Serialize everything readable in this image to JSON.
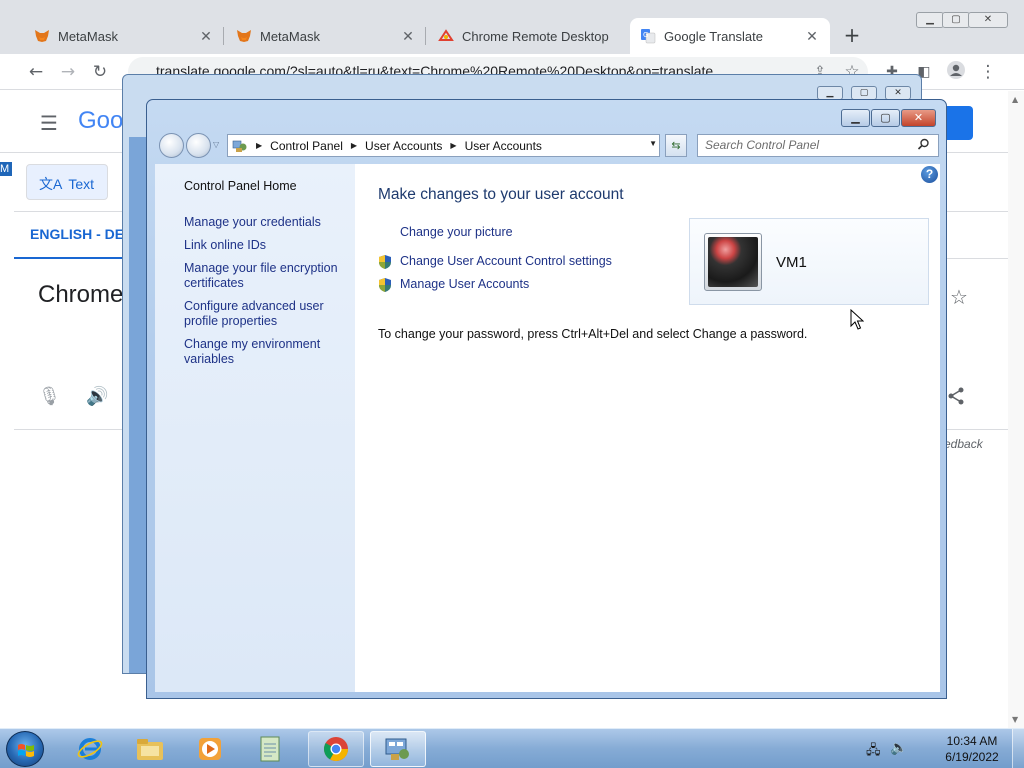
{
  "browser": {
    "tabs": [
      {
        "title": "MetaMask",
        "icon": "metamask-fox-icon",
        "active": false
      },
      {
        "title": "MetaMask",
        "icon": "metamask-fox-icon",
        "active": false
      },
      {
        "title": "Chrome Remote Desktop",
        "icon": "chrome-remote-desktop-icon",
        "active": false
      },
      {
        "title": "Google Translate",
        "icon": "google-translate-icon",
        "active": true
      }
    ],
    "new_tab_label": "+",
    "url": "translate.google.com/?sl=auto&tl=ru&text=Chrome%20Remote%20Desktop&op=translate"
  },
  "translate_page": {
    "logo_partial": "Goo",
    "text_tab": "Text",
    "source_lang_partial": "ENGLISH - DET",
    "source_text_partial": "Chrome",
    "feedback_partial": "edback"
  },
  "desktop_fragment": "M",
  "control_panel": {
    "breadcrumbs": [
      "Control Panel",
      "User Accounts",
      "User Accounts"
    ],
    "search_placeholder": "Search Control Panel",
    "nav": {
      "home": "Control Panel Home",
      "links": [
        "Manage your credentials",
        "Link online IDs",
        "Manage your file encryption certificates",
        "Configure advanced user profile properties",
        "Change my environment variables"
      ]
    },
    "title": "Make changes to your user account",
    "actions": [
      {
        "label": "Change your picture",
        "shield": false
      },
      {
        "label": "Change User Account Control settings",
        "shield": true
      },
      {
        "label": "Manage User Accounts",
        "shield": true
      }
    ],
    "password_note": "To change your password, press Ctrl+Alt+Del and select Change a password.",
    "user": {
      "name": "VM1"
    },
    "help_label": "?"
  },
  "taskbar": {
    "pinned": [
      "internet-explorer-icon",
      "windows-explorer-icon",
      "media-player-icon",
      "notepad-icon",
      "chrome-icon",
      "control-panel-icon"
    ],
    "clock": {
      "time": "10:34 AM",
      "date": "6/19/2022"
    }
  },
  "colors": {
    "link_blue": "#1e3287",
    "translate_blue": "#1967d2",
    "taskbar": "#8cafd7"
  }
}
